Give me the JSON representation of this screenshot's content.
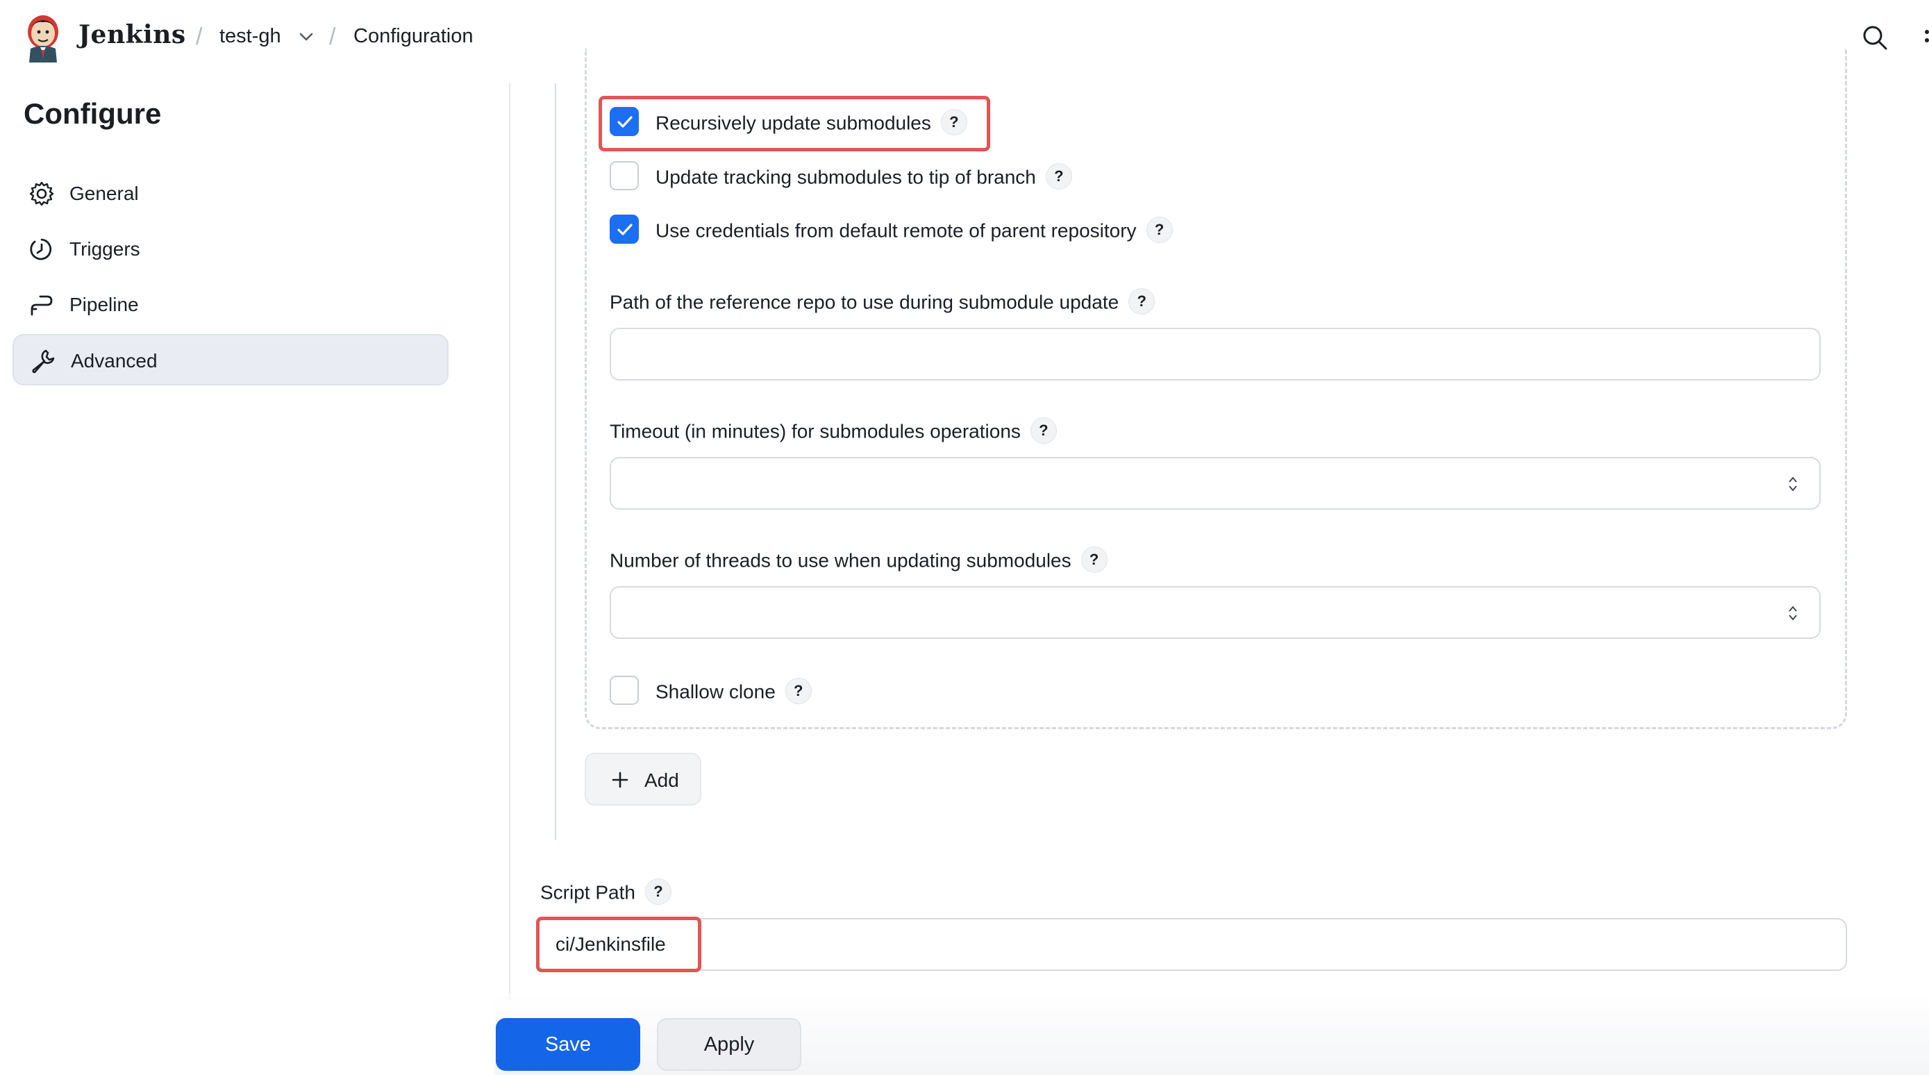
{
  "header": {
    "brand": "Jenkins",
    "breadcrumbs": [
      "test-gh",
      "Configuration"
    ]
  },
  "sidebar": {
    "title": "Configure",
    "items": [
      {
        "label": "General",
        "icon": "gear-icon",
        "active": false
      },
      {
        "label": "Triggers",
        "icon": "clock-icon",
        "active": false
      },
      {
        "label": "Pipeline",
        "icon": "pipeline-icon",
        "active": false
      },
      {
        "label": "Advanced",
        "icon": "wrench-icon",
        "active": true
      }
    ]
  },
  "submodule_options": {
    "recursive": {
      "label": "Recursively update submodules",
      "checked": true
    },
    "tracking": {
      "label": "Update tracking submodules to tip of branch",
      "checked": false
    },
    "parent_credentials": {
      "label": "Use credentials from default remote of parent repository",
      "checked": true
    },
    "reference_path": {
      "label": "Path of the reference repo to use during submodule update",
      "value": ""
    },
    "timeout": {
      "label": "Timeout (in minutes) for submodules operations",
      "value": ""
    },
    "threads": {
      "label": "Number of threads to use when updating submodules",
      "value": ""
    },
    "shallow_clone": {
      "label": "Shallow clone",
      "checked": false
    }
  },
  "help_glyph": "?",
  "add_button": {
    "label": "Add"
  },
  "script_path": {
    "label": "Script Path",
    "value": "ci/Jenkinsfile"
  },
  "footer": {
    "save_label": "Save",
    "apply_label": "Apply"
  },
  "colors": {
    "primary": "#1565e8",
    "checkbox_on": "#1c6ef2",
    "highlight": "#e25555"
  }
}
